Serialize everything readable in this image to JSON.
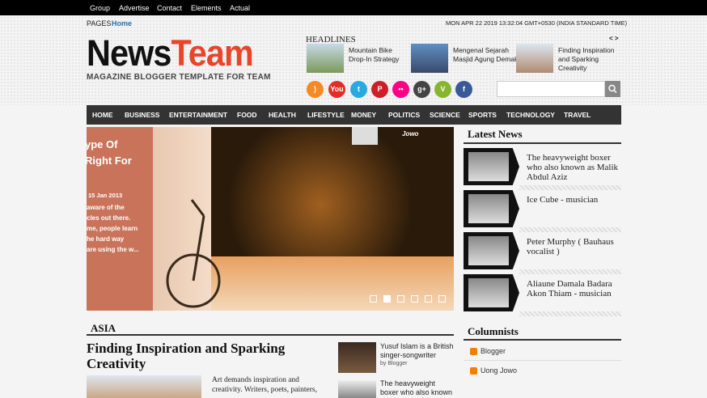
{
  "topbar": {
    "items": [
      "Group",
      "Advertise",
      "Contact",
      "Elements",
      "Actual"
    ]
  },
  "crumb": {
    "pages": "PAGES",
    "home": "Home"
  },
  "datetime": "MON APR 22 2019 13:32:04 GMT+0530 (INDIA STANDARD TIME)",
  "logo": {
    "part1": "News",
    "part2": "Team",
    "tagline": "MAGAZINE BLOGGER TEMPLATE FOR TEAM"
  },
  "headlines": {
    "title": "HEADLINES",
    "nav": "< >",
    "items": [
      {
        "text": "Mountain Bike Drop-In Strategy"
      },
      {
        "text": "Mengenal Sejarah Masjid Agung Demak"
      },
      {
        "text": "Finding Inspiration and Sparking Creativity"
      }
    ]
  },
  "social": [
    {
      "icon": "rss-icon",
      "label": ")",
      "color": "#f58a25"
    },
    {
      "icon": "youtube-icon",
      "label": "You",
      "color": "#e52d27"
    },
    {
      "icon": "twitter-icon",
      "label": "t",
      "color": "#2aa9e0"
    },
    {
      "icon": "pinterest-icon",
      "label": "P",
      "color": "#cb2027"
    },
    {
      "icon": "flickr-icon",
      "label": "••",
      "color": "#ff0084"
    },
    {
      "icon": "googleplus-icon",
      "label": "g+",
      "color": "#444"
    },
    {
      "icon": "vimeo-icon",
      "label": "V",
      "color": "#86b52f"
    },
    {
      "icon": "facebook-icon",
      "label": "f",
      "color": "#3b5998"
    }
  ],
  "nav": [
    "HOME",
    "BUSINESS",
    "ENTERTAINMENT",
    "FOOD",
    "HEALTH",
    "LIFESTYLE",
    "MONEY",
    "POLITICS",
    "SCIENCE",
    "SPORTS",
    "TECHNOLOGY",
    "TRAVEL"
  ],
  "slider": {
    "title_line1": "ype Of",
    "title_line2": "Right For",
    "date": "15 Jan 2013",
    "excerpt": [
      "aware of the",
      "cles out there.",
      "me, people learn",
      "he hard way",
      "are using the w..."
    ],
    "author": "Jowo",
    "slides": 6,
    "active": 2
  },
  "latest": {
    "title": "Latest News",
    "items": [
      {
        "text": "The heavyweight boxer who also known as Malik Abdul Aziz"
      },
      {
        "text": "Ice Cube - musician"
      },
      {
        "text": "Peter Murphy ( Bauhaus vocalist )"
      },
      {
        "text": "Aliaune Damala Badara Akon Thiam - musician"
      }
    ]
  },
  "columnists": {
    "title": "Columnists",
    "items": [
      "Blogger",
      "Uong Jowo"
    ]
  },
  "asia": {
    "title": "ASIA",
    "headline": "Finding Inspiration and Sparking Creativity",
    "excerpt": "Art demands inspiration and creativity. Writers, poets, painters,",
    "side": [
      {
        "text": "Yusuf Islam is a British singer-songwriter",
        "author": "by Blogger"
      },
      {
        "text": "The heavyweight boxer who also known as"
      }
    ]
  }
}
